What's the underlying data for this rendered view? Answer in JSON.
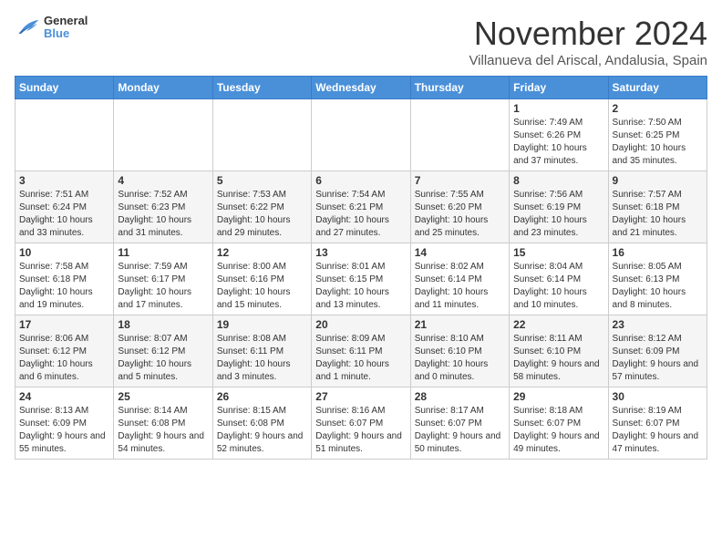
{
  "logo": {
    "general": "General",
    "blue": "Blue"
  },
  "header": {
    "month": "November 2024",
    "location": "Villanueva del Ariscal, Andalusia, Spain"
  },
  "weekdays": [
    "Sunday",
    "Monday",
    "Tuesday",
    "Wednesday",
    "Thursday",
    "Friday",
    "Saturday"
  ],
  "weeks": [
    [
      {
        "day": "",
        "info": ""
      },
      {
        "day": "",
        "info": ""
      },
      {
        "day": "",
        "info": ""
      },
      {
        "day": "",
        "info": ""
      },
      {
        "day": "",
        "info": ""
      },
      {
        "day": "1",
        "info": "Sunrise: 7:49 AM\nSunset: 6:26 PM\nDaylight: 10 hours and 37 minutes."
      },
      {
        "day": "2",
        "info": "Sunrise: 7:50 AM\nSunset: 6:25 PM\nDaylight: 10 hours and 35 minutes."
      }
    ],
    [
      {
        "day": "3",
        "info": "Sunrise: 7:51 AM\nSunset: 6:24 PM\nDaylight: 10 hours and 33 minutes."
      },
      {
        "day": "4",
        "info": "Sunrise: 7:52 AM\nSunset: 6:23 PM\nDaylight: 10 hours and 31 minutes."
      },
      {
        "day": "5",
        "info": "Sunrise: 7:53 AM\nSunset: 6:22 PM\nDaylight: 10 hours and 29 minutes."
      },
      {
        "day": "6",
        "info": "Sunrise: 7:54 AM\nSunset: 6:21 PM\nDaylight: 10 hours and 27 minutes."
      },
      {
        "day": "7",
        "info": "Sunrise: 7:55 AM\nSunset: 6:20 PM\nDaylight: 10 hours and 25 minutes."
      },
      {
        "day": "8",
        "info": "Sunrise: 7:56 AM\nSunset: 6:19 PM\nDaylight: 10 hours and 23 minutes."
      },
      {
        "day": "9",
        "info": "Sunrise: 7:57 AM\nSunset: 6:18 PM\nDaylight: 10 hours and 21 minutes."
      }
    ],
    [
      {
        "day": "10",
        "info": "Sunrise: 7:58 AM\nSunset: 6:18 PM\nDaylight: 10 hours and 19 minutes."
      },
      {
        "day": "11",
        "info": "Sunrise: 7:59 AM\nSunset: 6:17 PM\nDaylight: 10 hours and 17 minutes."
      },
      {
        "day": "12",
        "info": "Sunrise: 8:00 AM\nSunset: 6:16 PM\nDaylight: 10 hours and 15 minutes."
      },
      {
        "day": "13",
        "info": "Sunrise: 8:01 AM\nSunset: 6:15 PM\nDaylight: 10 hours and 13 minutes."
      },
      {
        "day": "14",
        "info": "Sunrise: 8:02 AM\nSunset: 6:14 PM\nDaylight: 10 hours and 11 minutes."
      },
      {
        "day": "15",
        "info": "Sunrise: 8:04 AM\nSunset: 6:14 PM\nDaylight: 10 hours and 10 minutes."
      },
      {
        "day": "16",
        "info": "Sunrise: 8:05 AM\nSunset: 6:13 PM\nDaylight: 10 hours and 8 minutes."
      }
    ],
    [
      {
        "day": "17",
        "info": "Sunrise: 8:06 AM\nSunset: 6:12 PM\nDaylight: 10 hours and 6 minutes."
      },
      {
        "day": "18",
        "info": "Sunrise: 8:07 AM\nSunset: 6:12 PM\nDaylight: 10 hours and 5 minutes."
      },
      {
        "day": "19",
        "info": "Sunrise: 8:08 AM\nSunset: 6:11 PM\nDaylight: 10 hours and 3 minutes."
      },
      {
        "day": "20",
        "info": "Sunrise: 8:09 AM\nSunset: 6:11 PM\nDaylight: 10 hours and 1 minute."
      },
      {
        "day": "21",
        "info": "Sunrise: 8:10 AM\nSunset: 6:10 PM\nDaylight: 10 hours and 0 minutes."
      },
      {
        "day": "22",
        "info": "Sunrise: 8:11 AM\nSunset: 6:10 PM\nDaylight: 9 hours and 58 minutes."
      },
      {
        "day": "23",
        "info": "Sunrise: 8:12 AM\nSunset: 6:09 PM\nDaylight: 9 hours and 57 minutes."
      }
    ],
    [
      {
        "day": "24",
        "info": "Sunrise: 8:13 AM\nSunset: 6:09 PM\nDaylight: 9 hours and 55 minutes."
      },
      {
        "day": "25",
        "info": "Sunrise: 8:14 AM\nSunset: 6:08 PM\nDaylight: 9 hours and 54 minutes."
      },
      {
        "day": "26",
        "info": "Sunrise: 8:15 AM\nSunset: 6:08 PM\nDaylight: 9 hours and 52 minutes."
      },
      {
        "day": "27",
        "info": "Sunrise: 8:16 AM\nSunset: 6:07 PM\nDaylight: 9 hours and 51 minutes."
      },
      {
        "day": "28",
        "info": "Sunrise: 8:17 AM\nSunset: 6:07 PM\nDaylight: 9 hours and 50 minutes."
      },
      {
        "day": "29",
        "info": "Sunrise: 8:18 AM\nSunset: 6:07 PM\nDaylight: 9 hours and 49 minutes."
      },
      {
        "day": "30",
        "info": "Sunrise: 8:19 AM\nSunset: 6:07 PM\nDaylight: 9 hours and 47 minutes."
      }
    ]
  ]
}
